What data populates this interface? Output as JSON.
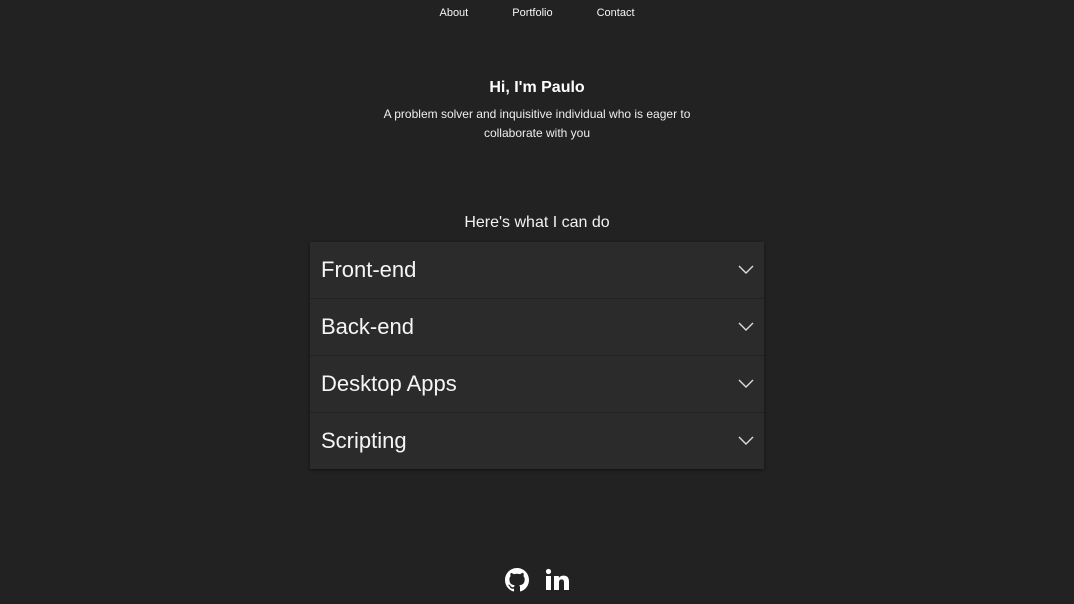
{
  "nav": {
    "items": [
      {
        "label": "About"
      },
      {
        "label": "Portfolio"
      },
      {
        "label": "Contact"
      }
    ]
  },
  "hero": {
    "title": "Hi, I'm Paulo",
    "subtitle": "A problem solver and inquisitive individual who is eager to collaborate with you"
  },
  "services": {
    "heading": "Here's what I can do",
    "items": [
      {
        "label": "Front-end",
        "icon": "chevron-down-icon"
      },
      {
        "label": "Back-end",
        "icon": "chevron-down-icon"
      },
      {
        "label": "Desktop Apps",
        "icon": "chevron-down-icon"
      },
      {
        "label": "Scripting",
        "icon": "chevron-down-icon"
      }
    ]
  },
  "footer": {
    "links": [
      {
        "icon": "github-icon"
      },
      {
        "icon": "linkedin-icon"
      }
    ]
  },
  "colors": {
    "background": "#222222",
    "panel": "#2b2b2b",
    "text": "#f2f2f2"
  }
}
